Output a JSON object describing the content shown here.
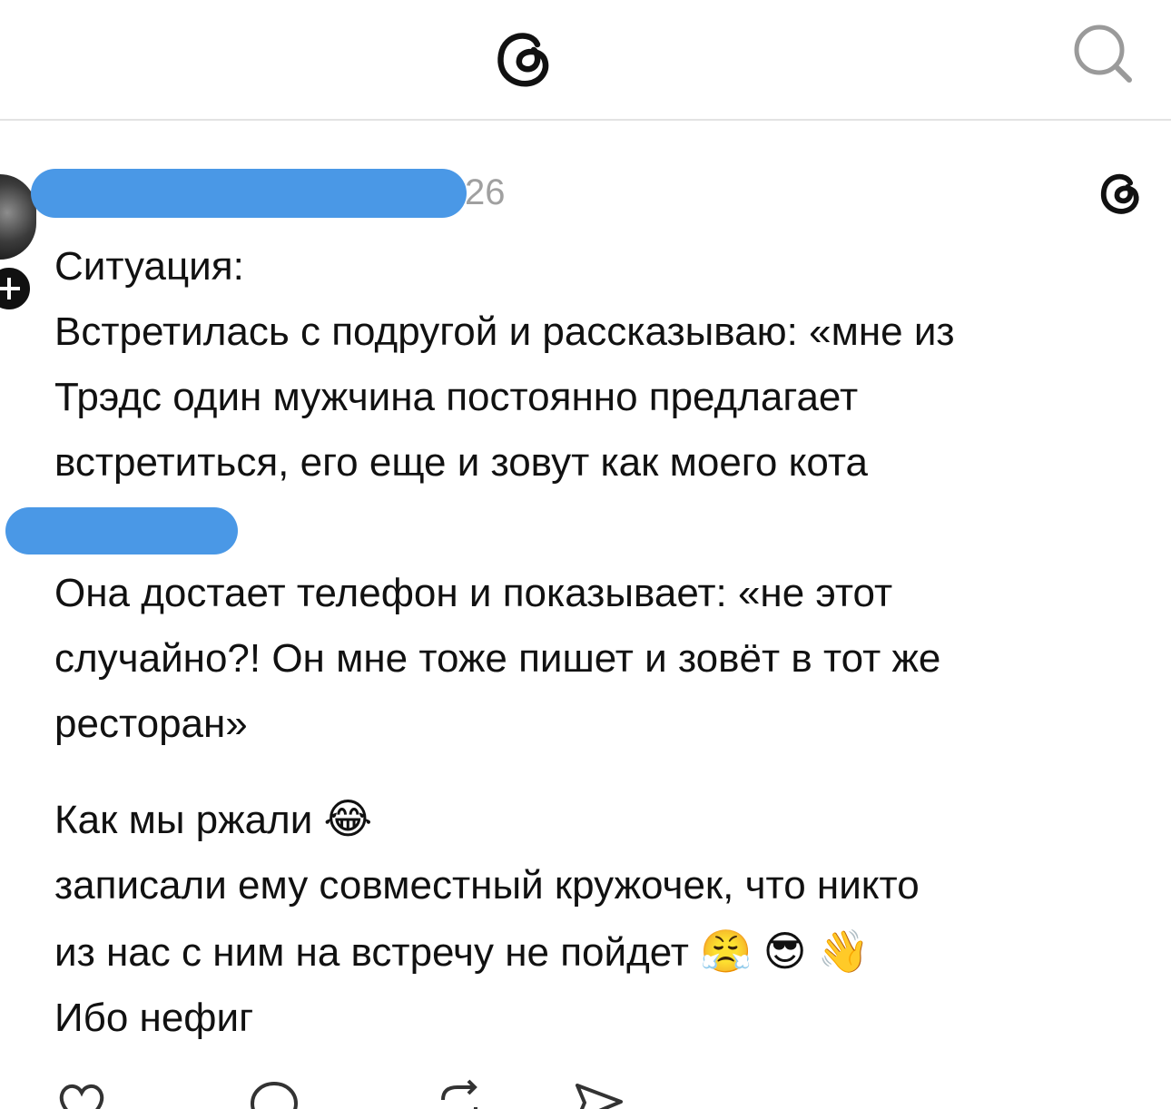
{
  "top_bar": {
    "logo_icon": "threads-logo-icon",
    "search_icon": "search-icon"
  },
  "post": {
    "username": "",
    "timestamp": "26",
    "lines": {
      "l1": "Ситуация:",
      "l2": "Встретилась с подругой и рассказываю: «мне из",
      "l3": "Трэдс один мужчина постоянно предлагает",
      "l4": "встретиться, его еще и зовут как моего кота",
      "l5": "Она достает телефон и показывает: «не этот",
      "l6": "случайно?! Он мне тоже пишет и зовёт в тот же",
      "l7": "ресторан»",
      "l8": "Как мы ржали",
      "l9": "записали ему совместный кружочек, что никто",
      "l10": "из нас с ним на встречу не пойдет",
      "l11": "Ибо нефиг"
    },
    "emoji": {
      "laugh": "😂",
      "angry": "😤",
      "cool": "😎",
      "wave": "👋"
    },
    "actions": {
      "like_count": "",
      "reply_count": "",
      "repost_count": "",
      "share_count": ""
    }
  },
  "colors": {
    "redaction": "#4a98e6",
    "timestamp": "#a0a0a0",
    "divider": "#e3e3e3"
  }
}
